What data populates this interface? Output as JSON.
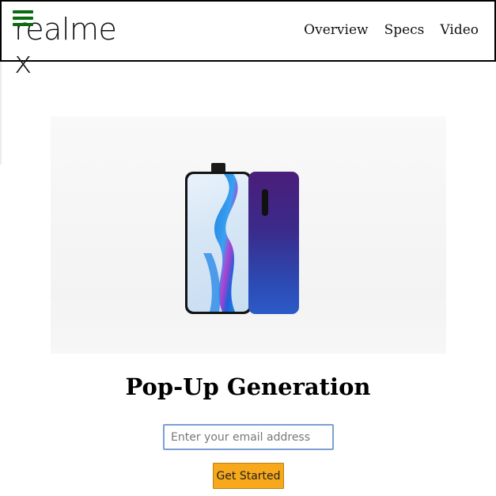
{
  "header": {
    "logo_text": "realme x",
    "nav": [
      {
        "label": "Overview"
      },
      {
        "label": "Specs"
      },
      {
        "label": "Video"
      }
    ]
  },
  "hero": {
    "image_alt": "realme X phone front and back"
  },
  "main": {
    "headline": "Pop-Up Generation",
    "email_placeholder": "Enter your email address",
    "cta_label": "Get Started"
  },
  "colors": {
    "hamburger": "#0b6b11",
    "cta_bg": "#f7a81b",
    "input_border": "#7d9fd3"
  }
}
